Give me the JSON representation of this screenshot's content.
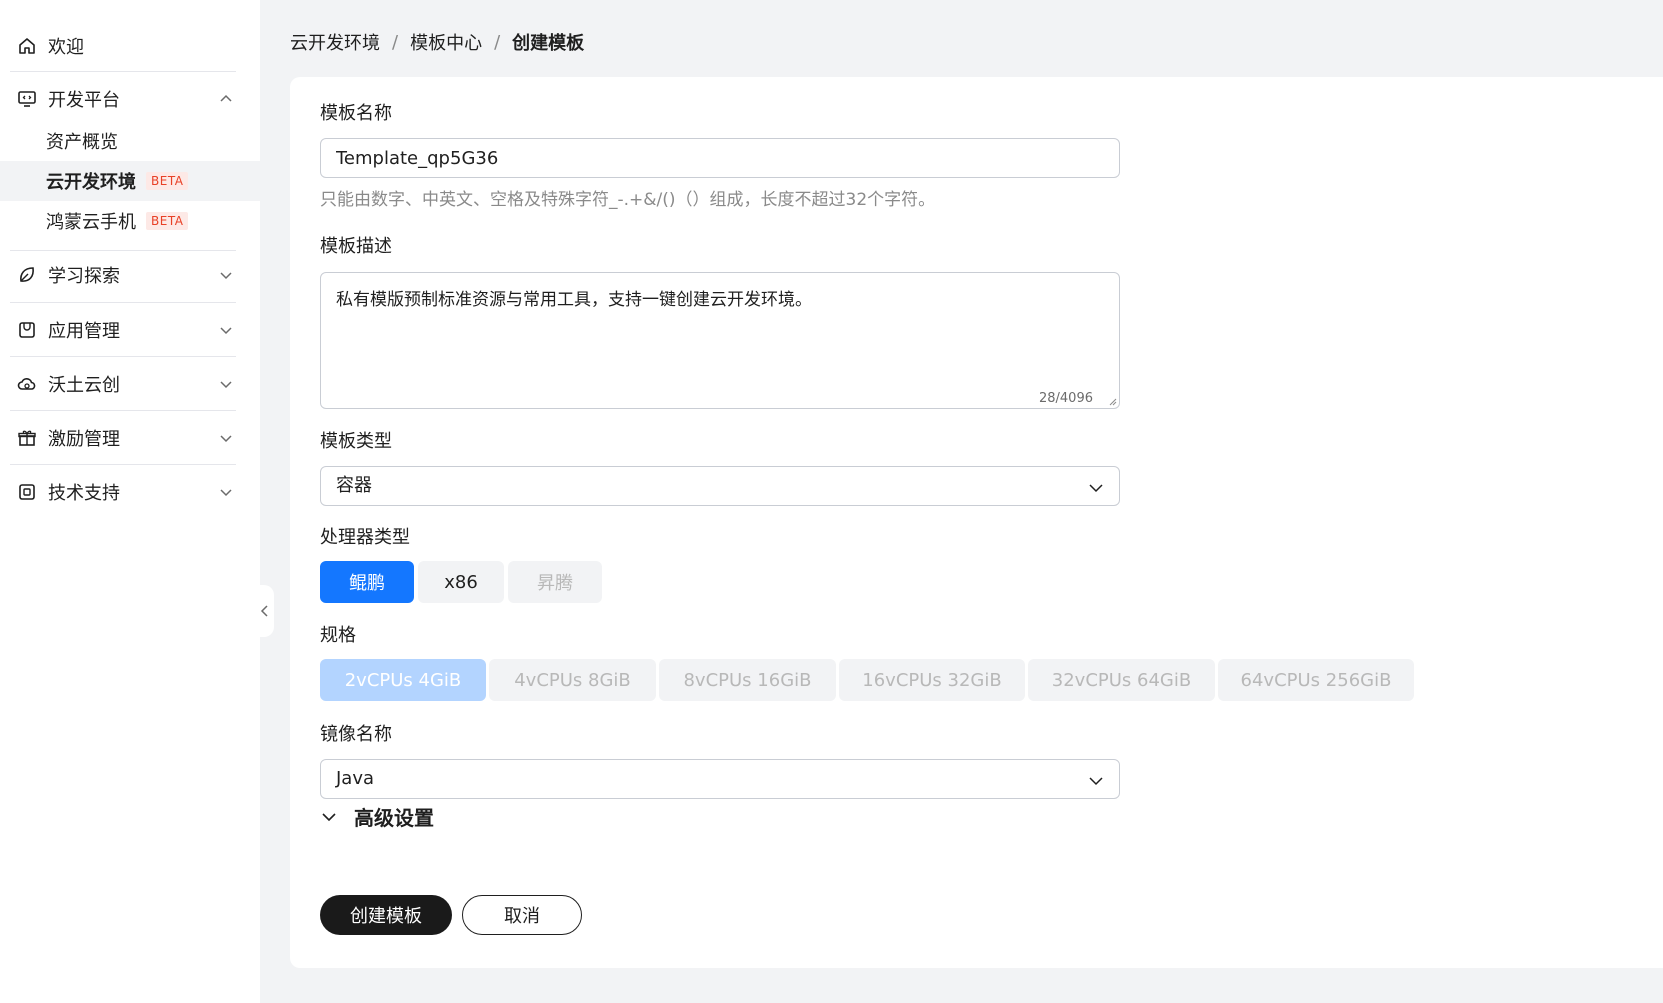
{
  "sidebar": {
    "welcome": {
      "label": "欢迎",
      "icon": "home-icon"
    },
    "dev_platform": {
      "label": "开发平台",
      "icon": "monitor-code-icon",
      "expanded": true,
      "children": [
        {
          "label": "资产概览",
          "beta": ""
        },
        {
          "label": "云开发环境",
          "beta": "BETA",
          "active": true
        },
        {
          "label": "鸿蒙云手机",
          "beta": "BETA"
        }
      ]
    },
    "groups": [
      {
        "label": "学习探索",
        "icon": "leaf-icon"
      },
      {
        "label": "应用管理",
        "icon": "app-bag-icon"
      },
      {
        "label": "沃土云创",
        "icon": "cloud-icon"
      },
      {
        "label": "激励管理",
        "icon": "gift-icon"
      },
      {
        "label": "技术支持",
        "icon": "support-icon"
      }
    ]
  },
  "breadcrumb": {
    "items": [
      "云开发环境",
      "模板中心"
    ],
    "current": "创建模板",
    "separator": "/"
  },
  "form": {
    "name": {
      "label": "模板名称",
      "value": "Template_qp5G36",
      "hint": "只能由数字、中英文、空格及特殊字符_-.+&/()（）组成，长度不超过32个字符。"
    },
    "description": {
      "label": "模板描述",
      "value": "私有模版预制标准资源与常用工具，支持一键创建云开发环境。",
      "counter": "28/4096"
    },
    "type": {
      "label": "模板类型",
      "value": "容器"
    },
    "cpu_type": {
      "label": "处理器类型",
      "options": [
        "鲲鹏",
        "x86",
        "昇腾"
      ],
      "selected": "鲲鹏"
    },
    "spec": {
      "label": "规格",
      "options": [
        "2vCPUs 4GiB",
        "4vCPUs 8GiB",
        "8vCPUs 16GiB",
        "16vCPUs 32GiB",
        "32vCPUs 64GiB",
        "64vCPUs 256GiB"
      ],
      "selected": "2vCPUs 4GiB"
    },
    "image": {
      "label": "镜像名称",
      "value": "Java"
    },
    "advanced": {
      "label": "高级设置"
    },
    "submit_label": "创建模板",
    "cancel_label": "取消"
  },
  "colors": {
    "primary": "#1477ff",
    "beta_text": "#e84026",
    "dark_button": "#1a1a1a"
  }
}
